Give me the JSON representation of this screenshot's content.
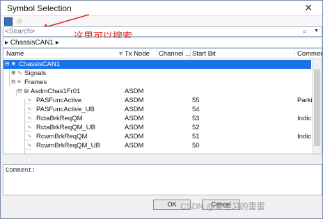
{
  "window": {
    "title": "Symbol Selection",
    "close_glyph": "✕"
  },
  "search": {
    "placeholder": "<Search>",
    "annotation": "这里可以搜索"
  },
  "breadcrumb": {
    "text": "▸ ChassisCAN1 ▸"
  },
  "columns": [
    "Name",
    "Tx Node",
    "Channel ...",
    "Start Bit",
    "Commen"
  ],
  "rows": [
    {
      "name": "ChassisCAN1",
      "tx": "",
      "channel": "",
      "start": "",
      "comment": "",
      "selected": true
    },
    {
      "name": "Signals",
      "tx": "",
      "channel": "",
      "start": "",
      "comment": ""
    },
    {
      "name": "Frames",
      "tx": "",
      "channel": "",
      "start": "",
      "comment": ""
    },
    {
      "name": "AsdmChas1Fr01",
      "tx": "ASDM",
      "channel": "",
      "start": "",
      "comment": ""
    },
    {
      "name": "PASFuncActive",
      "tx": "ASDM",
      "channel": "",
      "start": "55",
      "comment": "Parki"
    },
    {
      "name": "PASFuncActive_UB",
      "tx": "ASDM",
      "channel": "",
      "start": "54",
      "comment": ""
    },
    {
      "name": "RctaBrkReqQM",
      "tx": "ASDM",
      "channel": "",
      "start": "53",
      "comment": "Indic"
    },
    {
      "name": "RctaBrkReqQM_UB",
      "tx": "ASDM",
      "channel": "",
      "start": "52",
      "comment": ""
    },
    {
      "name": "RcwmBrkReqQM",
      "tx": "ASDM",
      "channel": "",
      "start": "51",
      "comment": "Indic"
    },
    {
      "name": "RcwmBrkReqQM_UB",
      "tx": "ASDM",
      "channel": "",
      "start": "50",
      "comment": ""
    }
  ],
  "comment_label": "Comment:",
  "buttons": {
    "ok": "OK",
    "cancel": "Cancel"
  },
  "watermark": "CSDN @爱学习的雷雷",
  "colors": {
    "selection": "#1a73e8",
    "annotation": "#e02020"
  }
}
